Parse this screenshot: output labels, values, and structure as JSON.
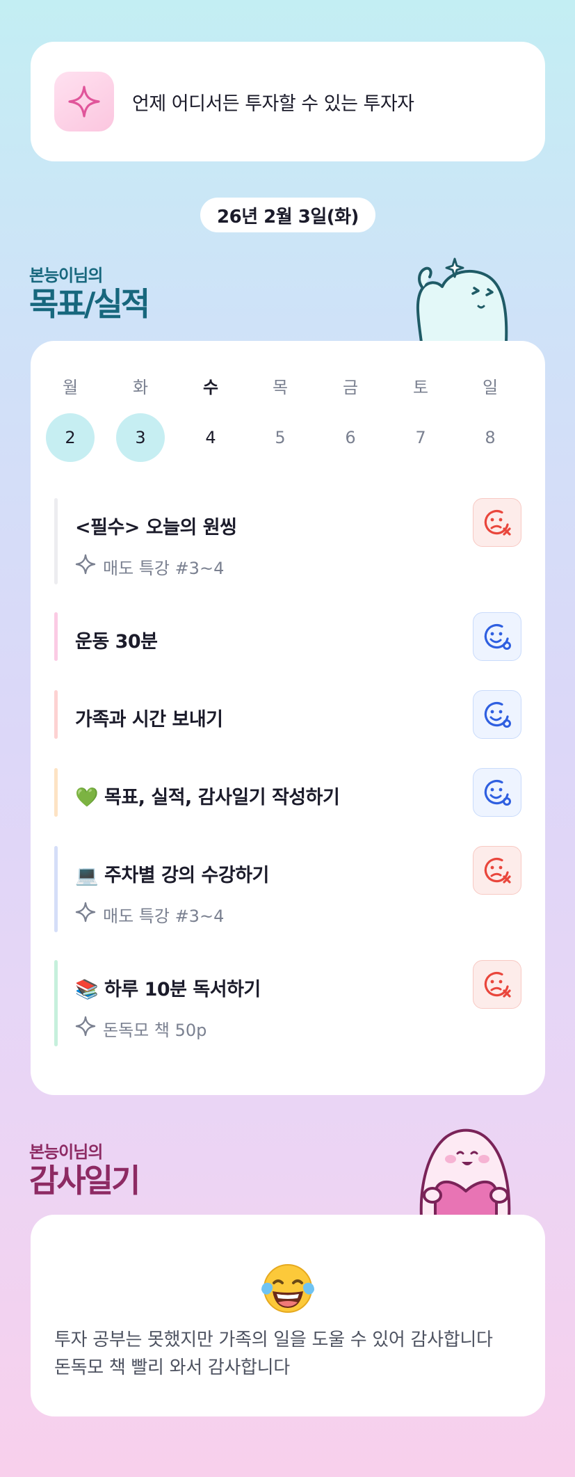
{
  "motto": {
    "text": "언제 어디서든 투자할 수 있는 투자자",
    "icon": "sparkle-icon"
  },
  "date": "26년 2월 3일(화)",
  "goals_section": {
    "subtitle": "본능이님의",
    "title": "목표/실적"
  },
  "week": {
    "days": [
      {
        "label": "월",
        "num": "2",
        "state": "done"
      },
      {
        "label": "화",
        "num": "3",
        "state": "done"
      },
      {
        "label": "수",
        "num": "4",
        "state": "today"
      },
      {
        "label": "목",
        "num": "5",
        "state": "future"
      },
      {
        "label": "금",
        "num": "6",
        "state": "future"
      },
      {
        "label": "토",
        "num": "7",
        "state": "future"
      },
      {
        "label": "일",
        "num": "8",
        "state": "future"
      }
    ]
  },
  "goals": [
    {
      "title": "<필수> 오늘의 원씽",
      "sub": "매도 특강 #3~4",
      "status": "fail",
      "bar_color": "#ededf0"
    },
    {
      "title": "운동 30분",
      "sub": "",
      "status": "ok",
      "bar_color": "#fbcbe4"
    },
    {
      "title": "가족과 시간 보내기",
      "sub": "",
      "status": "ok",
      "bar_color": "#fdd2d2"
    },
    {
      "title": "💚 목표, 실적, 감사일기 작성하기",
      "sub": "",
      "status": "ok",
      "bar_color": "#fde3c4"
    },
    {
      "title": "💻 주차별 강의 수강하기",
      "sub": "매도 특강 #3~4",
      "status": "fail",
      "bar_color": "#d5def8"
    },
    {
      "title": "📚 하루 10분 독서하기",
      "sub": "돈독모 책 50p",
      "status": "fail",
      "bar_color": "#c6f0dc"
    }
  ],
  "gratitude_section": {
    "subtitle": "본능이님의",
    "title": "감사일기"
  },
  "gratitude": {
    "emoji": "😂",
    "lines": [
      "투자 공부는 못했지만 가족의 일을 도울 수 있어 감사합니다",
      "돈독모 책 빨리 와서 감사합니다"
    ]
  },
  "colors": {
    "fail": "#e9463c",
    "ok": "#2f5fe0",
    "accent_teal": "#17677d",
    "accent_plum": "#8d2a63"
  }
}
